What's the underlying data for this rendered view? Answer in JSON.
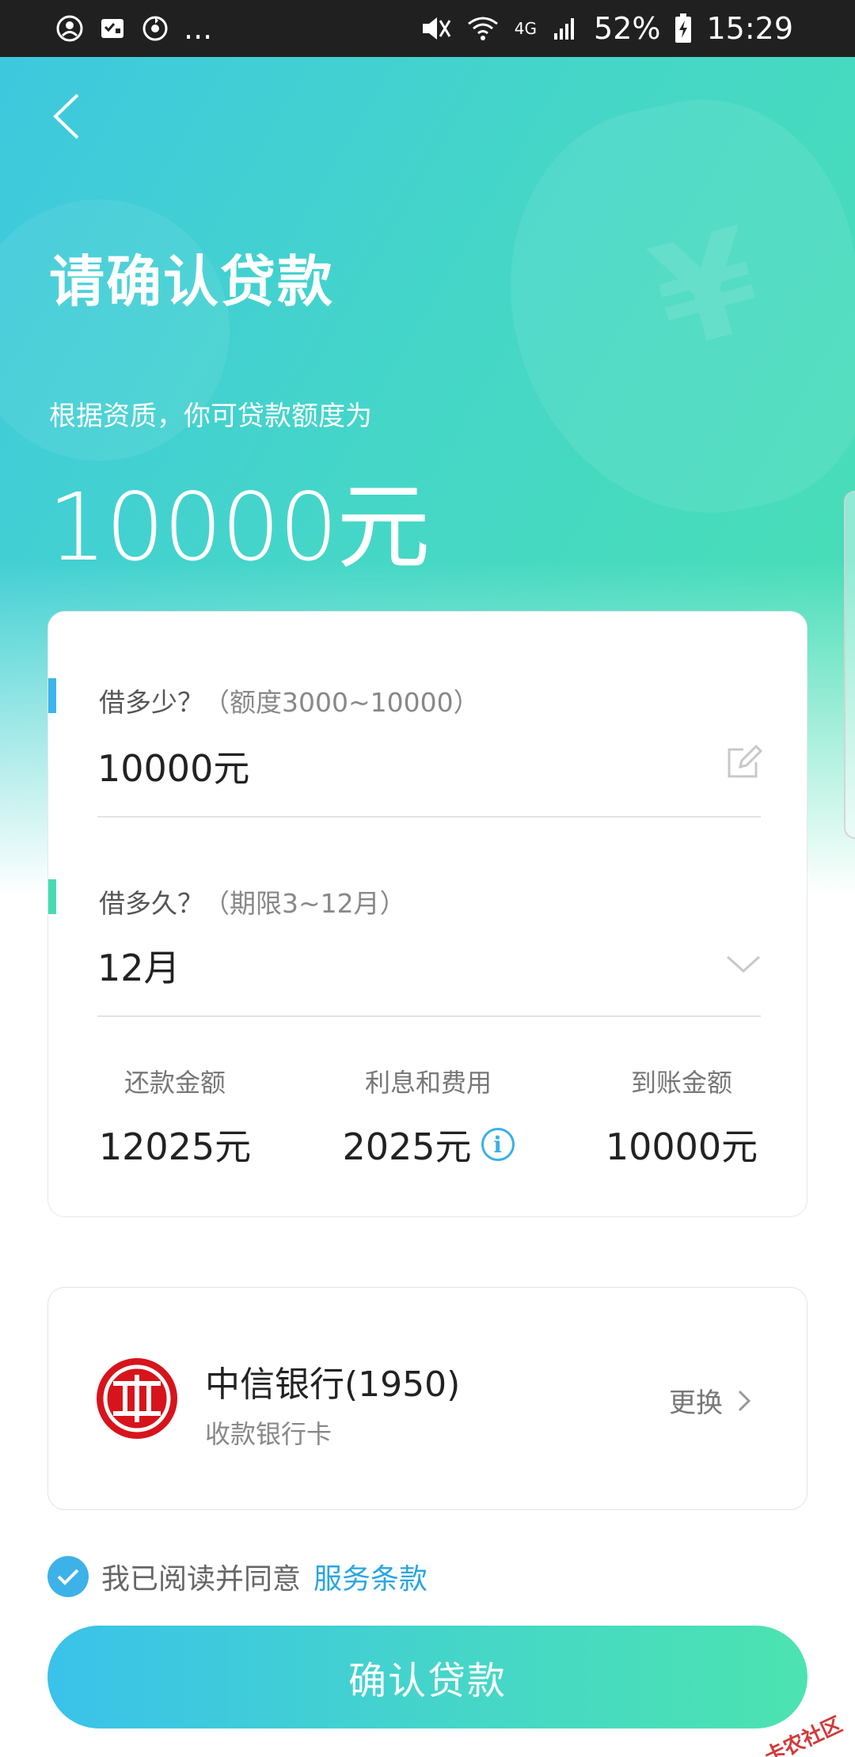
{
  "status_bar": {
    "more": "...",
    "network": "4G",
    "battery": "52%",
    "time": "15:29"
  },
  "header": {
    "title": "请确认贷款",
    "limit_label": "根据资质，你可贷款额度为",
    "limit_amount": "10000元"
  },
  "form": {
    "amount": {
      "label": "借多少？",
      "hint": "（额度3000~10000）",
      "value": "10000元",
      "marker_color": "#3ab6ea"
    },
    "term": {
      "label": "借多久？",
      "hint": "（期限3~12月）",
      "value": "12月",
      "marker_color": "#45dcb4"
    },
    "summary": [
      {
        "label": "还款金额",
        "value": "12025元"
      },
      {
        "label": "利息和费用",
        "value": "2025元"
      },
      {
        "label": "到账金额",
        "value": "10000元"
      }
    ]
  },
  "bank": {
    "name": "中信银行(1950)",
    "subtitle": "收款银行卡",
    "change_label": "更换",
    "brand_color": "#d7141c"
  },
  "agreement": {
    "checked": true,
    "text": "我已阅读并同意",
    "link": "服务条款"
  },
  "confirm_label": "确认贷款",
  "watermark": "卡农社区",
  "colors": {
    "accent_blue": "#3ab6ea",
    "accent_green": "#45dcb4"
  }
}
